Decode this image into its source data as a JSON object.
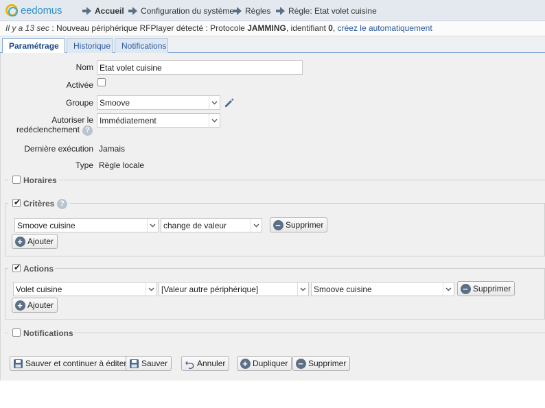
{
  "header": {
    "brand": "eedomus",
    "breadcrumb": [
      "Accueil",
      "Configuration du système",
      "Règles",
      "Règle: Etat volet cuisine"
    ]
  },
  "notice": {
    "time": "Il y a 13 sec",
    "text_before": " : Nouveau périphérique RFPlayer détecté : Protocole ",
    "protocol": "JAMMING",
    "text_middle": ", identifiant ",
    "identifier": "0",
    "text_after": ", ",
    "link": "créez le automatiquement"
  },
  "tabs": [
    "Paramétrage",
    "Historique",
    "Notifications"
  ],
  "form": {
    "nom_label": "Nom",
    "nom_value": "Etat volet cuisine",
    "activee_label": "Activée",
    "activee_checked": false,
    "groupe_label": "Groupe",
    "groupe_value": "Smoove",
    "autoriser_label_1": "Autoriser le",
    "autoriser_label_2": "redéclenchement",
    "autoriser_value": "Immédiatement",
    "derniere_label": "Dernière exécution",
    "derniere_value": "Jamais",
    "type_label": "Type",
    "type_value": "Règle locale"
  },
  "sections": {
    "horaires": {
      "label": "Horaires",
      "checked": false
    },
    "criteres": {
      "label": "Critères",
      "checked": true,
      "row": {
        "device": "Smoove cuisine",
        "condition": "change de valeur",
        "delete": "Supprimer"
      },
      "add": "Ajouter"
    },
    "actions": {
      "label": "Actions",
      "checked": true,
      "row": {
        "device": "Volet cuisine",
        "value_type": "[Valeur autre périphérique]",
        "source": "Smoove cuisine",
        "delete": "Supprimer"
      },
      "add": "Ajouter"
    },
    "notifications": {
      "label": "Notifications",
      "checked": false
    }
  },
  "buttons": {
    "save_continue": "Sauver et continuer à éditer",
    "save": "Sauver",
    "cancel": "Annuler",
    "duplicate": "Dupliquer",
    "delete": "Supprimer"
  }
}
